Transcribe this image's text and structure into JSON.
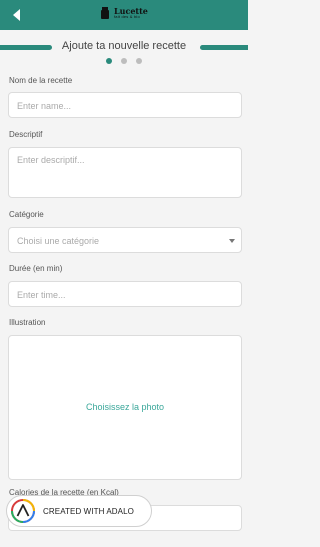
{
  "header": {
    "logo_main": "Lucette",
    "logo_sub": "fait des & bio"
  },
  "section": {
    "title": "Ajoute ta nouvelle recette"
  },
  "pager": {
    "count": 3,
    "active": 0
  },
  "form": {
    "name": {
      "label": "Nom de la recette",
      "placeholder": "Enter name..."
    },
    "description": {
      "label": "Descriptif",
      "placeholder": "Enter descriptif..."
    },
    "category": {
      "label": "Catégorie",
      "placeholder": "Choisi une catégorie"
    },
    "duration": {
      "label": "Durée (en min)",
      "placeholder": "Enter time..."
    },
    "illustration": {
      "label": "Illustration",
      "action": "Choisissez la photo"
    },
    "calories": {
      "label": "Calories de la recette (en Kcal)"
    }
  },
  "badge": {
    "text": "CREATED WITH ADALO"
  },
  "colors": {
    "accent": "#2a8a7c",
    "link": "#3aa79a"
  }
}
